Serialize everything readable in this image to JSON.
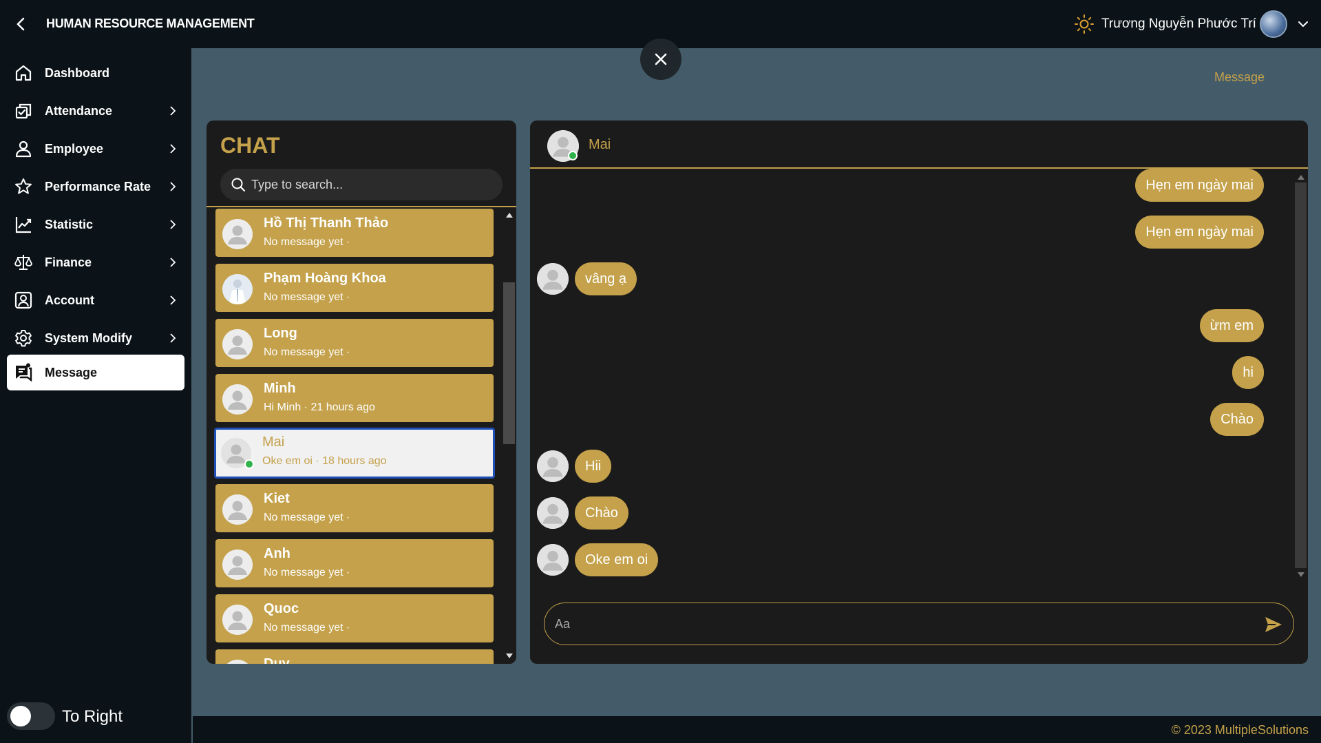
{
  "header": {
    "title": "HUMAN RESOURCE MANAGEMENT",
    "user_name": "Trương Nguyễn Phước Trí"
  },
  "sidebar": {
    "items": [
      {
        "label": "Dashboard",
        "icon": "home-icon",
        "has_submenu": false
      },
      {
        "label": "Attendance",
        "icon": "attendance-icon",
        "has_submenu": true
      },
      {
        "label": "Employee",
        "icon": "user-icon",
        "has_submenu": true
      },
      {
        "label": "Performance Rate",
        "icon": "star-icon",
        "has_submenu": true
      },
      {
        "label": "Statistic",
        "icon": "chart-icon",
        "has_submenu": true
      },
      {
        "label": "Finance",
        "icon": "scale-icon",
        "has_submenu": true
      },
      {
        "label": "Account",
        "icon": "account-icon",
        "has_submenu": true
      },
      {
        "label": "System Modify",
        "icon": "gear-icon",
        "has_submenu": true
      },
      {
        "label": "Message",
        "icon": "message-icon",
        "has_submenu": false,
        "active": true
      }
    ],
    "toggle_label": "To Right"
  },
  "breadcrumb": "Message",
  "chat": {
    "heading": "CHAT",
    "search_placeholder": "Type to search...",
    "contacts": [
      {
        "name": "Hồ Thị Thanh Thảo",
        "preview": "No message yet ·"
      },
      {
        "name": "Phạm Hoàng Khoa",
        "preview": "No message yet ·"
      },
      {
        "name": "Long",
        "preview": "No message yet ·"
      },
      {
        "name": "Minh",
        "preview": "Hi Minh · 21 hours ago"
      },
      {
        "name": "Mai",
        "preview": "Oke em oi · 18 hours ago",
        "active": true,
        "online": true
      },
      {
        "name": "Kiet",
        "preview": "No message yet ·"
      },
      {
        "name": "Anh",
        "preview": "No message yet ·"
      },
      {
        "name": "Quoc",
        "preview": "No message yet ·"
      },
      {
        "name": "Duy",
        "preview": ""
      }
    ]
  },
  "conversation": {
    "name": "Mai",
    "online": true,
    "messages": [
      {
        "text": "Hẹn em ngày mai",
        "from": "me"
      },
      {
        "text": "Hẹn em ngày mai",
        "from": "me"
      },
      {
        "text": "vâng ạ",
        "from": "them"
      },
      {
        "text": "ừm em",
        "from": "me"
      },
      {
        "text": "hi",
        "from": "me"
      },
      {
        "text": "Chào",
        "from": "me"
      },
      {
        "text": "Hii",
        "from": "them"
      },
      {
        "text": "Chào",
        "from": "them"
      },
      {
        "text": "Oke em oi",
        "from": "them"
      }
    ],
    "composer_placeholder": "Aa"
  },
  "footer": {
    "copyright": "© 2023 MultipleSolutions"
  },
  "colors": {
    "accent": "#c4a14a",
    "background": "#445c6a",
    "dark": "#0b1318",
    "panel": "#1b1b1b",
    "online": "#2fb34a"
  }
}
